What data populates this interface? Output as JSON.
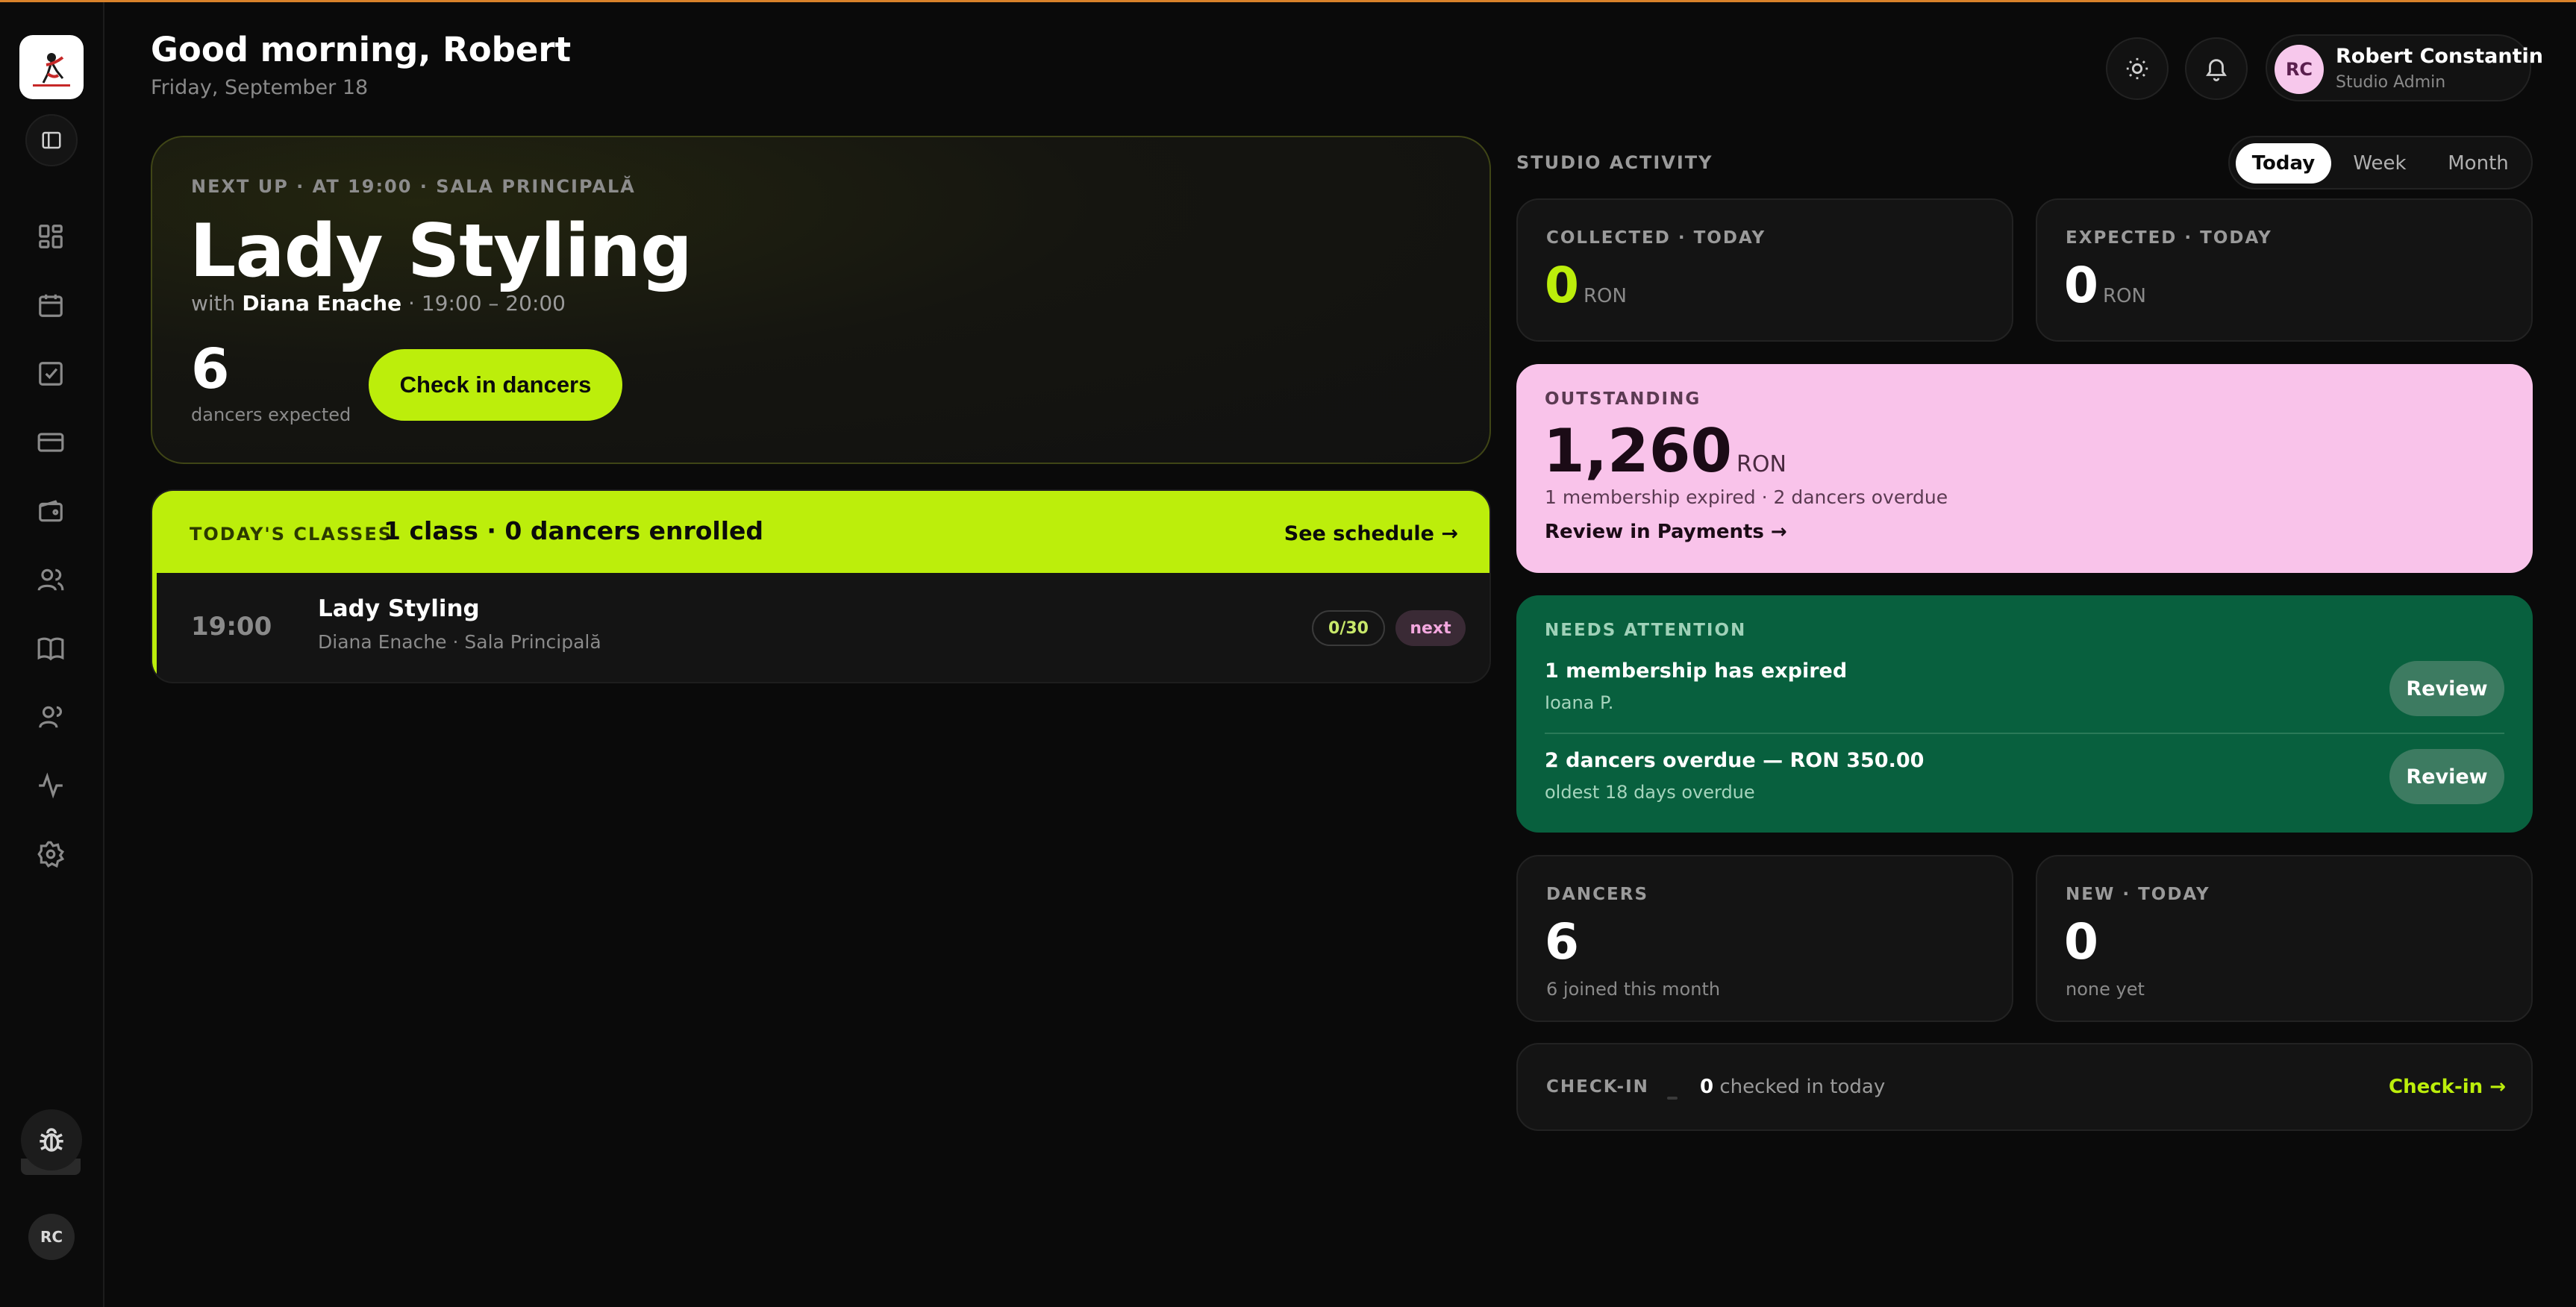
{
  "header": {
    "greeting": "Good morning, Robert",
    "date": "Friday, September 18"
  },
  "sidebar": {
    "logo_icon": "studio-logo",
    "items": [
      {
        "icon": "dashboard-icon"
      },
      {
        "icon": "calendar-icon"
      },
      {
        "icon": "checkbox-icon"
      },
      {
        "icon": "card-icon"
      },
      {
        "icon": "wallet-icon"
      },
      {
        "icon": "users-icon"
      },
      {
        "icon": "book-icon"
      },
      {
        "icon": "team-icon"
      },
      {
        "icon": "activity-icon"
      },
      {
        "icon": "gear-icon"
      }
    ],
    "avatar_initials": "RC"
  },
  "user": {
    "initials": "RC",
    "name": "Robert Constantin",
    "role": "Studio Admin"
  },
  "next_up": {
    "meta": "NEXT UP · AT 19:00   · SALA PRINCIPALĂ",
    "title": "Lady Styling",
    "with_prefix": "with",
    "instructor": "Diana Enache",
    "time_range": "· 19:00 – 20:00",
    "count": "6",
    "count_label": "dancers expected",
    "checkin_label": "Check in dancers"
  },
  "todays_classes": {
    "label": "TODAY'S CLASSES",
    "summary": "1 class · 0 dancers enrolled",
    "link": "See schedule →",
    "rows": [
      {
        "time": "19:00",
        "name": "Lady Styling",
        "sub": "Diana Enache · Sala Principală",
        "capacity": "0/30",
        "badge": "next"
      }
    ]
  },
  "activity": {
    "label": "STUDIO ACTIVITY",
    "tabs": [
      "Today",
      "Week",
      "Month"
    ],
    "active_tab": "Today",
    "collected": {
      "label": "COLLECTED · TODAY",
      "value": "0",
      "unit": "RON"
    },
    "expected": {
      "label": "EXPECTED · TODAY",
      "value": "0",
      "unit": "RON"
    },
    "outstanding": {
      "label": "OUTSTANDING",
      "value": "1,260",
      "unit": "RON",
      "sub": "1 membership expired · 2 dancers overdue",
      "link": "Review in Payments →"
    },
    "attention": {
      "label": "NEEDS ATTENTION",
      "items": [
        {
          "title": "1 membership has expired",
          "sub": "Ioana P.",
          "action": "Review"
        },
        {
          "title": "2 dancers overdue — RON 350.00",
          "sub": "oldest 18 days overdue",
          "action": "Review"
        }
      ]
    },
    "dancers": {
      "label": "DANCERS",
      "value": "6",
      "sub": "6 joined this month"
    },
    "new_today": {
      "label": "NEW · TODAY",
      "value": "0",
      "sub": "none yet"
    },
    "checkin": {
      "label": "CHECK-IN",
      "count": "0",
      "text": "checked in today",
      "link": "Check-in →"
    }
  },
  "colors": {
    "accent_lime": "#bcee0b",
    "outstanding_pink": "#f9c3ea",
    "attention_green": "#08603e",
    "background": "#0a0a0a",
    "top_line": "#d9822b"
  }
}
